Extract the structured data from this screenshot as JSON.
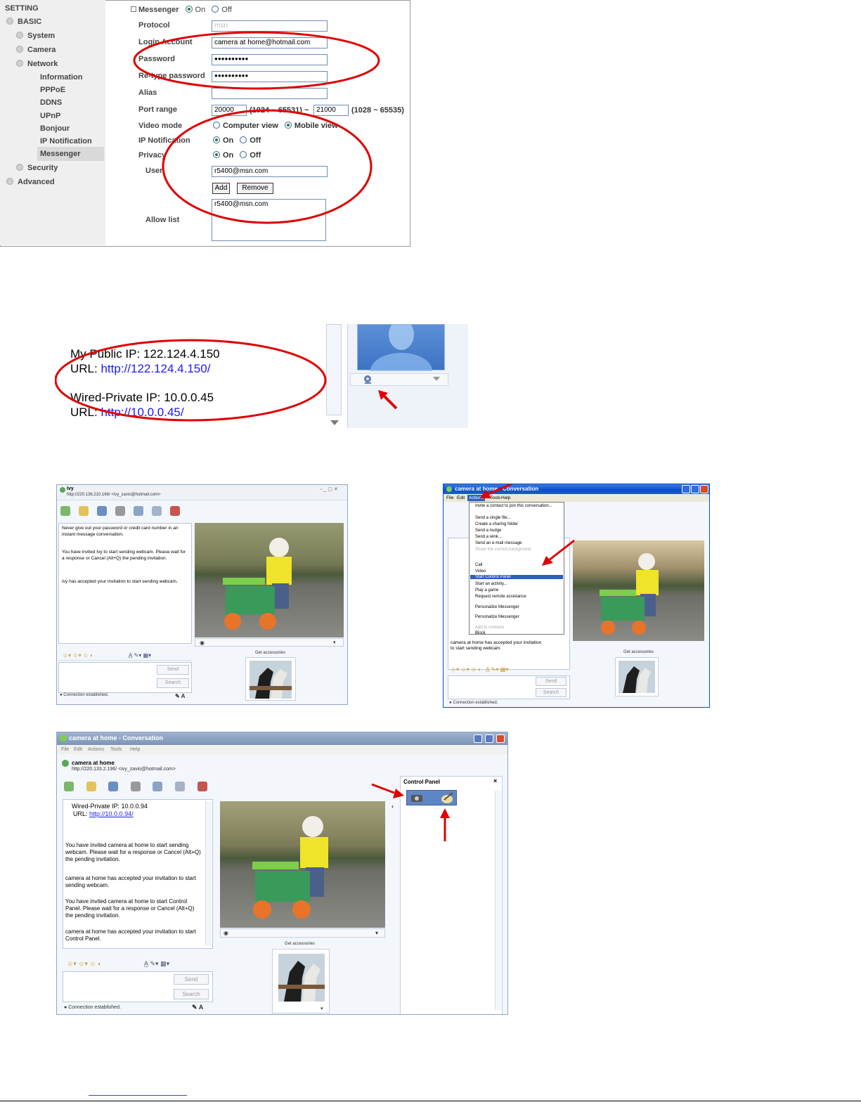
{
  "settings": {
    "setting_header": "SETTING",
    "tree": [
      {
        "label": "BASIC"
      },
      {
        "label": "System"
      },
      {
        "label": "Camera"
      },
      {
        "label": "Network"
      },
      {
        "label": "Information"
      },
      {
        "label": "PPPoE"
      },
      {
        "label": "DDNS"
      },
      {
        "label": "UPnP"
      },
      {
        "label": "Bonjour"
      },
      {
        "label": "IP Notification"
      },
      {
        "label": "Messenger"
      },
      {
        "label": "Security"
      },
      {
        "label": "Advanced"
      }
    ],
    "messenger_label": "Messenger",
    "on": "On",
    "off": "Off",
    "protocol_label": "Protocol",
    "protocol_value": "msn",
    "login_label": "Login Account",
    "login_value": "camera at home@hotmail.com",
    "password_label": "Password",
    "password_value": "●●●●●●●●●●",
    "retype_label": "Re-type password",
    "retype_value": "●●●●●●●●●●",
    "alias_label": "Alias",
    "port_label": "Port range",
    "port_from": "20000",
    "port_from_range": "(1024 ~ 65531) ~",
    "port_to": "21000",
    "port_to_range": "(1028 ~ 65535)",
    "video_label": "Video mode",
    "computer_view": "Computer view",
    "mobile_view": "Mobile view",
    "ipnotif_label": "IP Notification",
    "privacy_label": "Privacy",
    "user_label": "User",
    "user_value": "r5400@msn.com",
    "add_btn": "Add",
    "remove_btn": "Remove",
    "allow_label": "Allow list",
    "allow_value": "r5400@msn.com"
  },
  "ipinfo": {
    "public_ip": "My Public IP: 122.124.4.150",
    "url1_prefix": "URL:",
    "url1": "http://122.124.4.150/",
    "private_ip": "Wired-Private IP: 10.0.0.45",
    "url2_prefix": "URL:",
    "url2": "http://10.0.0.45/"
  },
  "conv1": {
    "name": "Ivy",
    "address": "http://220.136.210.166/ <ivy_zavio@hotmail.com>",
    "msg1": "Never give out your password or credit card number in an instant message conversation.",
    "msg2": "You have invited Ivy to start sending webcam. Please wait for a response or Cancel (Alt+Q) the pending invitation.",
    "msg3": "Ivy has accepted your invitation to start sending webcam.",
    "send": "Send",
    "search": "Search",
    "get_accessories": "Get accessories",
    "status": "Connection established."
  },
  "conv2": {
    "title": "camera at home - Conversation",
    "menu": [
      "File",
      "Edit",
      "Actions",
      "Tools",
      "Help"
    ],
    "actions_menu": [
      "Invite a contact to join this conversation...",
      "Send a single file...",
      "Create a sharing folder",
      "Send a nudge",
      "Send a wink...",
      "Send an e-mail message",
      "Share the current background",
      "Call",
      "Video",
      "Start Control Panel",
      "Start an activity...",
      "Play a game",
      "Request remote assistance",
      "Personalize Messenger",
      "Personalize Messenger",
      "Add to contacts",
      "Block"
    ],
    "side_msgs": [
      "camera at home has accepted your invitation to start sending webcam."
    ],
    "send": "Send",
    "search": "Search",
    "get_accessories": "Get accessories",
    "status": "Connection established."
  },
  "conv3": {
    "title": "camera at home - Conversation",
    "menu": [
      "File",
      "Edit",
      "Actions",
      "Tools",
      "Help"
    ],
    "name": "camera at home",
    "address": "http://220.133.2.196/ <ivy_zavio@hotmail.com>",
    "private_ip": "Wired-Private IP: 10.0.0.94",
    "url_prefix": "URL:",
    "url": "http://10.0.0.94/",
    "msg1": "You have invited camera at home to start sending webcam. Please wait for a response or Cancel (Alt+Q) the pending invitation.",
    "msg2": "camera at home has accepted your invitation to start sending webcam.",
    "msg3": "You have invited camera at home to start Control Panel. Please wait for a response or Cancel (Alt+Q) the pending invitation.",
    "msg4": "camera at home has accepted your invitation to start Control Panel.",
    "send": "Send",
    "search": "Search",
    "get_accessories": "Get accessories",
    "status": "Connection established.",
    "control_panel": "Control Panel"
  },
  "colors": {
    "annotation_red": "#e00000",
    "link_blue": "#1a1aff",
    "xp_blue": "#0a4ec4"
  },
  "icons": [
    "radio-icon",
    "webcam-icon",
    "arrow-icon",
    "camera-icon",
    "paint-icon",
    "emoticon-icon",
    "close-icon"
  ]
}
